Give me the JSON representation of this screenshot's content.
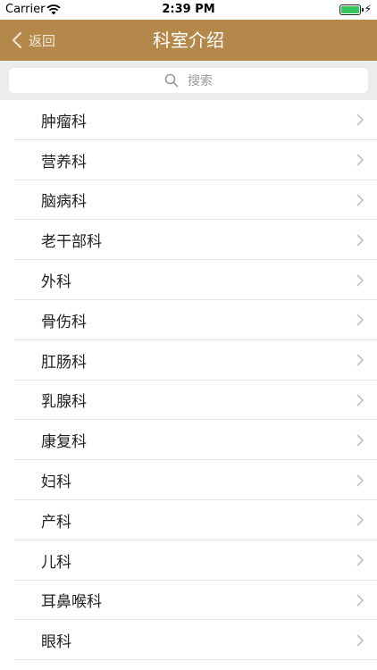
{
  "status_bar": {
    "carrier": "Carrier",
    "time": "2:39 PM"
  },
  "nav": {
    "back_label": "返回",
    "title": "科室介绍"
  },
  "search": {
    "placeholder": "搜索"
  },
  "departments": [
    "肿瘤科",
    "营养科",
    "脑病科",
    "老干部科",
    "外科",
    "骨伤科",
    "肛肠科",
    "乳腺科",
    "康复科",
    "妇科",
    "产科",
    "儿科",
    "耳鼻喉科",
    "眼科"
  ],
  "colors": {
    "accent": "#b4874a",
    "battery": "#35c759"
  }
}
